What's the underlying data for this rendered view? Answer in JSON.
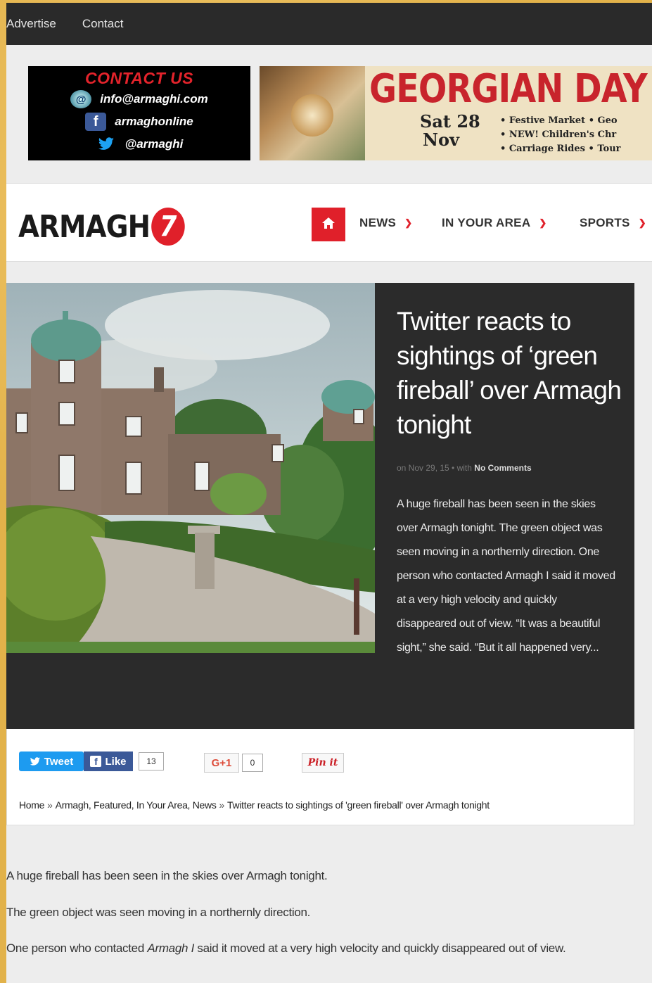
{
  "topnav": {
    "items": [
      "Advertise",
      "Contact"
    ]
  },
  "ads": {
    "contact": {
      "title": "CONTACT US",
      "email": "info@armaghi.com",
      "facebook": "armaghonline",
      "twitter": "@armaghi"
    },
    "georgian": {
      "headline": "GEORGIAN DAY A",
      "date_line1": "Sat 28",
      "date_line2": "Nov",
      "items": [
        "• Festive Market • Geo",
        "• NEW! Children's Chr",
        "• Carriage Rides • Tour"
      ]
    }
  },
  "header": {
    "logo_text": "ARMAGH",
    "logo_mark": "7",
    "nav": [
      "NEWS",
      "IN YOUR AREA",
      "SPORTS"
    ]
  },
  "hero": {
    "title": "Twitter reacts to sightings of ‘green fireball’ over Armagh tonight",
    "meta_prefix": "on Nov 29, 15 • with",
    "meta_comments": "No Comments",
    "excerpt": "A huge fireball has been seen in the skies over Armagh tonight. The green object was seen moving in a northernly direction. One person who contacted Armagh I said it moved at a very high velocity and quickly disappeared out of view. “It was a beautiful sight,” she said. “But it all happened very..."
  },
  "share": {
    "tweet_label": "Tweet",
    "like_label": "Like",
    "like_count": "13",
    "gplus_label": "G+1",
    "gplus_count": "0",
    "pin_label": "Pin it"
  },
  "breadcrumb": {
    "home": "Home",
    "categories": "Armagh, Featured, In Your Area, News",
    "current": "Twitter reacts to sightings of 'green fireball' over Armagh tonight"
  },
  "article": {
    "p1": "A huge fireball has been seen in the skies over Armagh tonight.",
    "p2": "The green object was seen moving in a northernly direction.",
    "p3_before": "One person who contacted ",
    "p3_em": "Armagh I",
    "p3_after": " said it moved at a very high velocity and quickly disappeared out of view."
  }
}
